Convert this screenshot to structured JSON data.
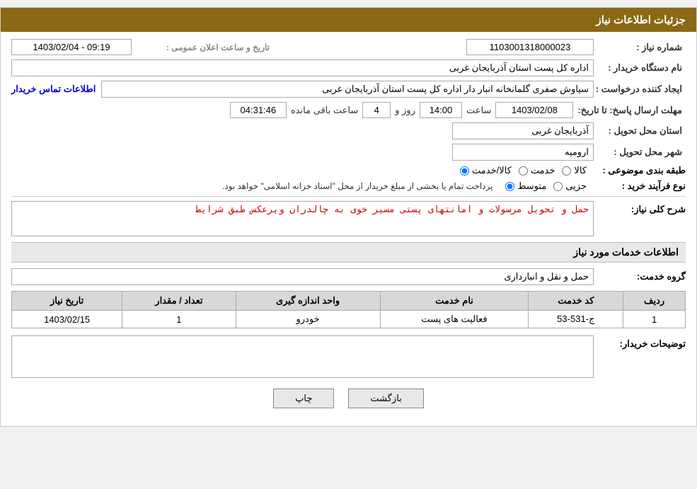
{
  "header": {
    "title": "جزئیات اطلاعات نیاز"
  },
  "fields": {
    "need_number_label": "شماره نیاز :",
    "need_number_value": "1103001318000023",
    "announce_label": "تاریخ و ساعت اعلان عمومی :",
    "announce_value": "1403/02/04 - 09:19",
    "buyer_org_label": "نام دستگاه خریدار :",
    "buyer_org_value": "اداره کل پست استان آذربایجان غربی",
    "creator_label": "ایجاد کننده درخواست :",
    "creator_value": "سیاوش صفری گلمانخانه انبار دار اداره کل پست استان آذربایجان غربی",
    "contact_link": "اطلاعات تماس خریدار",
    "deadline_label": "مهلت ارسال پاسخ: تا تاریخ:",
    "deadline_date": "1403/02/08",
    "deadline_time_label": "ساعت",
    "deadline_time": "14:00",
    "deadline_days_label": "روز و",
    "deadline_days": "4",
    "deadline_remaining_label": "ساعت باقی مانده",
    "deadline_remaining": "04:31:46",
    "province_label": "استان محل تحویل :",
    "province_value": "آذربایجان غربی",
    "city_label": "شهر محل تحویل :",
    "city_value": "ارومیه",
    "category_label": "طبقه بندی موضوعی :",
    "category_goods": "کالا",
    "category_service": "خدمت",
    "category_goods_service": "کالا/خدمت",
    "process_label": "نوع فرآیند خرید :",
    "process_partial": "جزیی",
    "process_medium": "متوسط",
    "process_full_text": "پرداخت تمام یا بخشی از مبلغ خریدار از محل \"اسناد خزانه اسلامی\" خواهد بود.",
    "description_label": "شرح کلی نیاز:",
    "description_value": "حمل و تحویل مرسولات و امانتهای پستی مسیر خوی به چالدران وبرعکس طبق شرایط",
    "services_section_title": "اطلاعات خدمات مورد نیاز",
    "service_group_label": "گروه خدمت:",
    "service_group_value": "حمل و نقل و انبارداری",
    "table": {
      "columns": [
        "ردیف",
        "کد خدمت",
        "نام خدمت",
        "واحد اندازه گیری",
        "تعداد / مقدار",
        "تاریخ نیاز"
      ],
      "rows": [
        [
          "1",
          "ج-531-53",
          "فعالیت های پست",
          "خودرو",
          "1",
          "1403/02/15"
        ]
      ]
    },
    "buyer_desc_label": "توضیحات خریدار:"
  },
  "buttons": {
    "back": "بازگشت",
    "print": "چاپ"
  }
}
